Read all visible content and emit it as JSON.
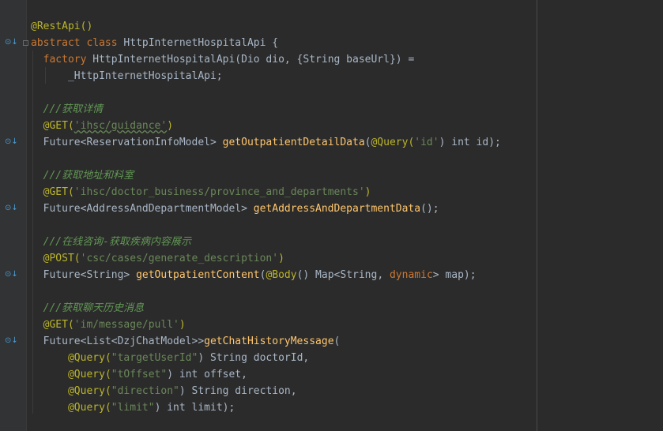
{
  "code": {
    "l1": [
      "@RestApi()"
    ],
    "l2": [
      "abstract",
      " ",
      "class",
      " HttpInternetHospitalApi {"
    ],
    "l3": [
      "factory",
      " HttpInternetHospitalApi(Dio dio, {String baseUrl}) ="
    ],
    "l4": [
      "_HttpInternetHospitalApi;"
    ],
    "l6": [
      "///获取详情"
    ],
    "l7": [
      "@GET",
      "(",
      "'ihsc/guidance'",
      ")"
    ],
    "l8": [
      "Future<ReservationInfoModel> ",
      "getOutpatientDetailData",
      "(",
      "@Query",
      "(",
      "'id'",
      ") int id);"
    ],
    "l10": [
      "///获取地址和科室"
    ],
    "l11": [
      "@GET",
      "(",
      "'ihsc/doctor_business/province_and_departments'",
      ")"
    ],
    "l12": [
      "Future<AddressAndDepartmentModel> ",
      "getAddressAndDepartmentData",
      "();"
    ],
    "l14": [
      "///在线咨询-获取疾病内容展示"
    ],
    "l15": [
      "@POST",
      "(",
      "'csc/cases/generate_description'",
      ")"
    ],
    "l16": [
      "Future<String> ",
      "getOutpatientContent",
      "(",
      "@Body",
      "() Map<String, ",
      "dynamic",
      "> map);"
    ],
    "l18": [
      "///获取聊天历史消息"
    ],
    "l19": [
      "@GET",
      "(",
      "'im/message/pull'",
      ")"
    ],
    "l20": [
      "Future<List<DzjChatModel>>",
      "getChatHistoryMessage",
      "("
    ],
    "l21": [
      "@Query",
      "(",
      "\"targetUserId\"",
      ") String doctorId,"
    ],
    "l22": [
      "@Query",
      "(",
      "\"tOffset\"",
      ") int offset,"
    ],
    "l23": [
      "@Query",
      "(",
      "\"direction\"",
      ") String direction,"
    ],
    "l24": [
      "@Query",
      "(",
      "\"limit\"",
      ") int limit);"
    ]
  },
  "gutter_icons": [
    "implementation-marker-icon"
  ]
}
